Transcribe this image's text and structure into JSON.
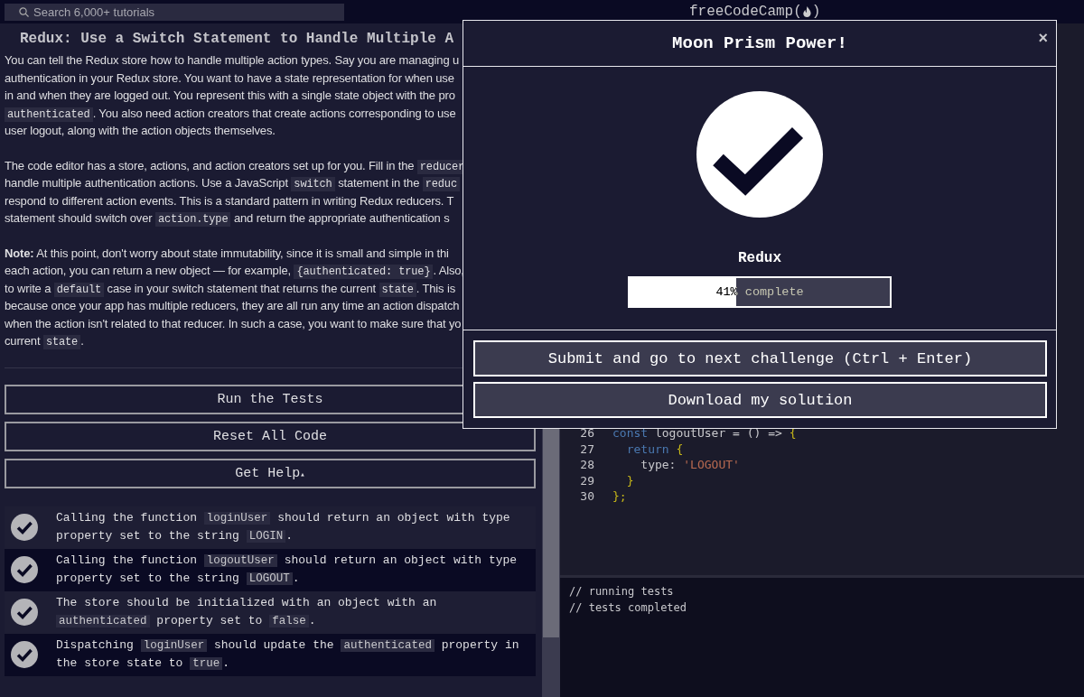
{
  "search": {
    "placeholder": "Search 6,000+ tutorials"
  },
  "brand": {
    "before": "freeCodeCamp(",
    "after": ")"
  },
  "challenge": {
    "title": "Redux: Use a Switch Statement to Handle Multiple A",
    "paragraphs": [
      {
        "lines": [
          [
            {
              "kind": "text",
              "text": "You can tell the Redux store how to handle multiple action types. Say you are managing u"
            }
          ],
          [
            {
              "kind": "text",
              "text": "authentication in your Redux store. You want to have a state representation for when use"
            }
          ],
          [
            {
              "kind": "text",
              "text": "in and when they are logged out. You represent this with a single state object with the pro"
            }
          ],
          [
            {
              "kind": "code",
              "text": "authenticated"
            },
            {
              "kind": "text",
              "text": ". You also need action creators that create actions corresponding to use"
            }
          ],
          [
            {
              "kind": "text",
              "text": "user logout, along with the action objects themselves."
            }
          ]
        ]
      },
      {
        "lines": [
          [
            {
              "kind": "text",
              "text": "The code editor has a store, actions, and action creators set up for you. Fill in the "
            },
            {
              "kind": "code",
              "text": "reducer"
            }
          ],
          [
            {
              "kind": "text",
              "text": "handle multiple authentication actions. Use a JavaScript "
            },
            {
              "kind": "code",
              "text": "switch"
            },
            {
              "kind": "text",
              "text": " statement in the "
            },
            {
              "kind": "code",
              "text": "reduc"
            }
          ],
          [
            {
              "kind": "text",
              "text": "respond to different action events. This is a standard pattern in writing Redux reducers. T"
            }
          ],
          [
            {
              "kind": "text",
              "text": "statement should switch over "
            },
            {
              "kind": "code",
              "text": "action.type"
            },
            {
              "kind": "text",
              "text": " and return the appropriate authentication s"
            }
          ]
        ]
      },
      {
        "lines": [
          [
            {
              "kind": "bold",
              "text": "Note:"
            },
            {
              "kind": "text",
              "text": " At this point, don't worry about state immutability, since it is small and simple in thi"
            }
          ],
          [
            {
              "kind": "text",
              "text": "each action, you can return a new object — for example, "
            },
            {
              "kind": "code",
              "text": "{authenticated: true}"
            },
            {
              "kind": "text",
              "text": ". Also,"
            }
          ],
          [
            {
              "kind": "text",
              "text": "to write a "
            },
            {
              "kind": "code",
              "text": "default"
            },
            {
              "kind": "text",
              "text": " case in your switch statement that returns the current "
            },
            {
              "kind": "code",
              "text": "state"
            },
            {
              "kind": "text",
              "text": ". This is"
            }
          ],
          [
            {
              "kind": "text",
              "text": "because once your app has multiple reducers, they are all run any time an action dispatch"
            }
          ],
          [
            {
              "kind": "text",
              "text": "when the action isn't related to that reducer. In such a case, you want to make sure that yo"
            }
          ],
          [
            {
              "kind": "text",
              "text": "current "
            },
            {
              "kind": "code",
              "text": "state"
            },
            {
              "kind": "text",
              "text": "."
            }
          ]
        ]
      }
    ]
  },
  "buttons": [
    "Run the Tests",
    "Reset All Code",
    "Get Help"
  ],
  "help_caret": "▴",
  "tests": [
    {
      "passed": true,
      "segments": [
        {
          "kind": "text",
          "text": "Calling the function "
        },
        {
          "kind": "code",
          "text": "loginUser"
        },
        {
          "kind": "text",
          "text": " should return an object with type property set to the string "
        },
        {
          "kind": "code",
          "text": "LOGIN"
        },
        {
          "kind": "text",
          "text": "."
        }
      ]
    },
    {
      "passed": true,
      "segments": [
        {
          "kind": "text",
          "text": "Calling the function "
        },
        {
          "kind": "code",
          "text": "logoutUser"
        },
        {
          "kind": "text",
          "text": " should return an object with type property set to the string "
        },
        {
          "kind": "code",
          "text": "LOGOUT"
        },
        {
          "kind": "text",
          "text": "."
        }
      ]
    },
    {
      "passed": true,
      "segments": [
        {
          "kind": "text",
          "text": "The store should be initialized with an object with an "
        },
        {
          "kind": "code",
          "text": "authenticated"
        },
        {
          "kind": "text",
          "text": " property set to "
        },
        {
          "kind": "code",
          "text": "false"
        },
        {
          "kind": "text",
          "text": "."
        }
      ]
    },
    {
      "passed": true,
      "segments": [
        {
          "kind": "text",
          "text": "Dispatching "
        },
        {
          "kind": "code",
          "text": "loginUser"
        },
        {
          "kind": "text",
          "text": " should update the "
        },
        {
          "kind": "code",
          "text": "authenticated"
        },
        {
          "kind": "text",
          "text": " property in the store state to "
        },
        {
          "kind": "code",
          "text": "true"
        },
        {
          "kind": "text",
          "text": "."
        }
      ]
    }
  ],
  "editor": {
    "lines": [
      {
        "number": "26",
        "tokens": [
          {
            "kind": "keyword",
            "text": "const"
          },
          {
            "kind": "plain",
            "text": " logoutUser = () => "
          },
          {
            "kind": "punct",
            "text": "{"
          }
        ]
      },
      {
        "number": "27",
        "tokens": [
          {
            "kind": "keyword",
            "text": "  return"
          },
          {
            "kind": "punct",
            "text": " {"
          }
        ]
      },
      {
        "number": "28",
        "tokens": [
          {
            "kind": "plain",
            "text": "    type: "
          },
          {
            "kind": "string",
            "text": "'LOGOUT'"
          }
        ]
      },
      {
        "number": "29",
        "tokens": [
          {
            "kind": "punct",
            "text": "  }"
          }
        ]
      },
      {
        "number": "30",
        "tokens": [
          {
            "kind": "punct",
            "text": "};"
          }
        ]
      }
    ]
  },
  "console": [
    "// running tests",
    "// tests completed"
  ],
  "modal": {
    "title": "Moon Prism Power!",
    "close": "×",
    "block": "Redux",
    "progress": {
      "level": 0.41,
      "label": "41% complete"
    },
    "buttons": [
      "Submit and go to next challenge (Ctrl + Enter)",
      "Download my solution"
    ]
  }
}
